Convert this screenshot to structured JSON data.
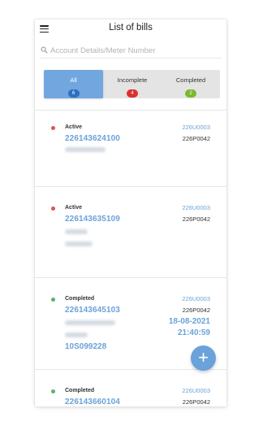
{
  "header": {
    "title": "List of bills"
  },
  "search": {
    "placeholder": "Account Details/Meter Number",
    "value": ""
  },
  "tabs": [
    {
      "label": "All",
      "count": "6",
      "active": true,
      "badge_color": "#2f6fbf"
    },
    {
      "label": "Incomplete",
      "count": "4",
      "active": false,
      "badge_color": "#d9312f"
    },
    {
      "label": "Completed",
      "count": "2",
      "active": false,
      "badge_color": "#7cb82f"
    }
  ],
  "colors": {
    "active": "#e05252",
    "completed": "#5ab36a",
    "accent": "#6aa2d9"
  },
  "bills": [
    {
      "status": "Active",
      "account": "226143624100",
      "code1": "226U0003",
      "code2": "226P0042"
    },
    {
      "status": "Active",
      "account": "226143635109",
      "code1": "226U0003",
      "code2": "226P0042"
    },
    {
      "status": "Completed",
      "account": "226143645103",
      "code1": "226U0003",
      "code2": "226P0042",
      "date": "18-08-2021",
      "time": "21:40:59",
      "meter": "10S099228"
    },
    {
      "status": "Completed",
      "account": "226143660104",
      "code1": "226U0003",
      "code2": "226P0042"
    }
  ],
  "fab": {
    "icon": "plus-icon",
    "label": "+"
  }
}
